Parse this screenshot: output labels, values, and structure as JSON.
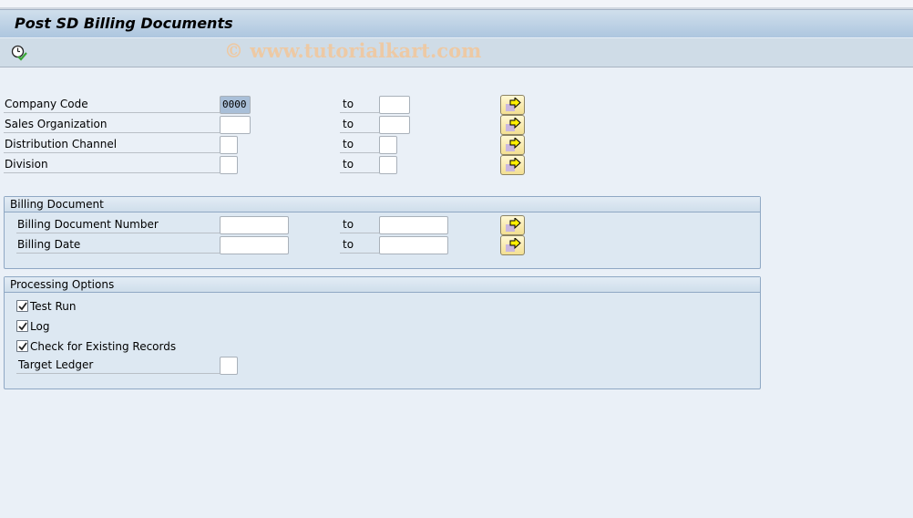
{
  "header": {
    "title": "Post SD Billing Documents",
    "watermark": "© www.tutorialkart.com"
  },
  "toolbar": {
    "execute_icon": "execute-clock-check-icon"
  },
  "selection": {
    "to_label": "to",
    "rows": [
      {
        "label": "Company Code",
        "from": "0000",
        "to": ""
      },
      {
        "label": "Sales Organization",
        "from": "",
        "to": ""
      },
      {
        "label": "Distribution Channel",
        "from": "",
        "to": ""
      },
      {
        "label": "Division",
        "from": "",
        "to": ""
      }
    ]
  },
  "billing_document": {
    "title": "Billing Document",
    "rows": [
      {
        "label": "Billing Document Number",
        "from": "",
        "to": ""
      },
      {
        "label": "Billing Date",
        "from": "",
        "to": ""
      }
    ]
  },
  "processing_options": {
    "title": "Processing Options",
    "checkboxes": [
      {
        "label": "Test Run",
        "checked": true
      },
      {
        "label": "Log",
        "checked": true
      },
      {
        "label": "Check for Existing Records",
        "checked": true
      }
    ],
    "target_ledger": {
      "label": "Target Ledger",
      "value": ""
    }
  },
  "icons": {
    "multiple_selection": "multiple-selection-arrow-icon",
    "checkmark": "checkmark-icon"
  },
  "colors": {
    "title_bar": "#adc6df",
    "toolbar": "#cfdce7",
    "background": "#eaf0f7",
    "group_bg": "#dde8f2",
    "button_yellow": "#f3df92",
    "selected_field": "#a9bfd8"
  }
}
